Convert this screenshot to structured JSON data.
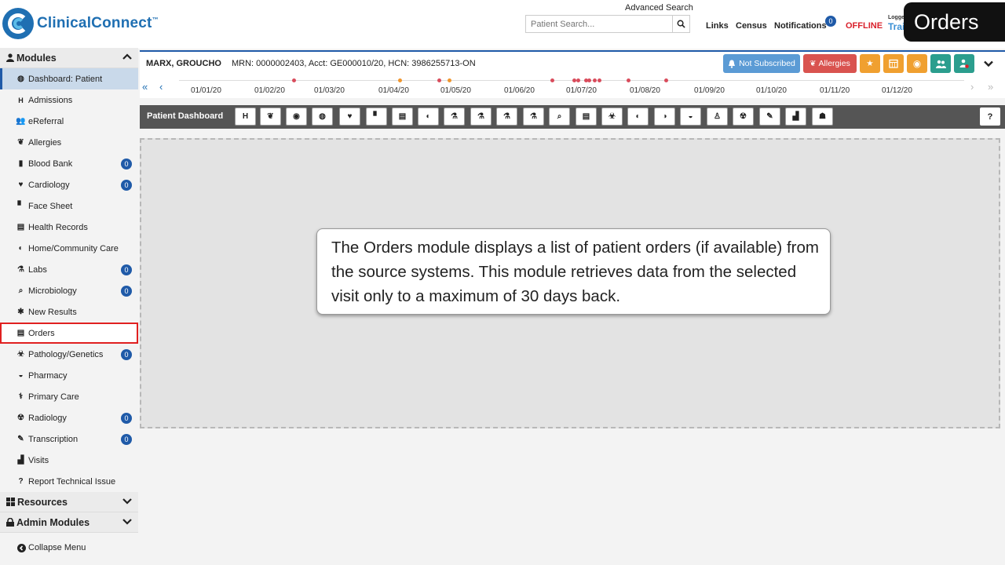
{
  "app": {
    "logo_text": "ClinicalConnect",
    "logo_tm": "™",
    "advanced_search": "Advanced Search",
    "search_placeholder": "Patient Search...",
    "links": "Links",
    "census": "Census",
    "notifications": "Notifications",
    "notifications_count": "0",
    "status": "OFFLINE",
    "logged_label": "Logge",
    "user_partial": "Trai",
    "module_title": "Orders",
    "colors": {
      "brand": "#1f6fb2",
      "offline": "#d9202b",
      "badge": "#1f5aa8",
      "highlight": "#e02020"
    }
  },
  "sidebar": {
    "modules_label": "Modules",
    "items": [
      {
        "label": "Dashboard: Patient",
        "icon": "dashboard-icon",
        "count": null
      },
      {
        "label": "Admissions",
        "icon": "hospital-h-icon",
        "count": null
      },
      {
        "label": "eReferral",
        "icon": "users-icon",
        "count": null
      },
      {
        "label": "Allergies",
        "icon": "allergy-icon",
        "count": null
      },
      {
        "label": "Blood Bank",
        "icon": "blood-bag-icon",
        "count": "0"
      },
      {
        "label": "Cardiology",
        "icon": "heart-icon",
        "count": "0"
      },
      {
        "label": "Face Sheet",
        "icon": "document-icon",
        "count": null
      },
      {
        "label": "Health Records",
        "icon": "records-icon",
        "count": null
      },
      {
        "label": "Home/Community Care",
        "icon": "home-care-icon",
        "count": null
      },
      {
        "label": "Labs",
        "icon": "flask-icon",
        "count": "0"
      },
      {
        "label": "Microbiology",
        "icon": "microscope-icon",
        "count": "0"
      },
      {
        "label": "New Results",
        "icon": "new-results-icon",
        "count": null
      },
      {
        "label": "Orders",
        "icon": "clipboard-icon",
        "count": null
      },
      {
        "label": "Pathology/Genetics",
        "icon": "biohazard-icon",
        "count": "0"
      },
      {
        "label": "Pharmacy",
        "icon": "mortar-icon",
        "count": null
      },
      {
        "label": "Primary Care",
        "icon": "stethoscope-icon",
        "count": null
      },
      {
        "label": "Radiology",
        "icon": "radiation-icon",
        "count": "0"
      },
      {
        "label": "Transcription",
        "icon": "edit-icon",
        "count": "0"
      },
      {
        "label": "Visits",
        "icon": "chart-icon",
        "count": null
      },
      {
        "label": "Report Technical Issue",
        "icon": "question-icon",
        "count": null
      }
    ],
    "resources_label": "Resources",
    "admin_label": "Admin Modules",
    "collapse_label": "Collapse Menu"
  },
  "patient": {
    "name": "MARX, GROUCHO",
    "info": "MRN: 0000002403, Acct: GE000010/20, HCN: 3986255713-ON",
    "not_subscribed": "Not Subscribed",
    "allergies": "Allergies"
  },
  "timeline": {
    "labels": [
      "01/01/20",
      "01/02/20",
      "01/03/20",
      "01/04/20",
      "01/05/20",
      "01/06/20",
      "01/07/20",
      "01/08/20",
      "01/09/20",
      "01/10/20",
      "01/11/20",
      "01/12/20"
    ]
  },
  "dashboard": {
    "title": "Patient Dashboard",
    "help": "?",
    "tools": [
      "H",
      "allergy",
      "blood",
      "blood-o",
      "heart",
      "doc",
      "print",
      "home",
      "flask",
      "micro",
      "flask2",
      "flask3",
      "search",
      "clip",
      "bio",
      "pill",
      "pill2",
      "pill3",
      "person",
      "rad",
      "edit",
      "chart",
      "users"
    ]
  },
  "callout": {
    "text": "The Orders module displays a list of patient orders (if available) from the source systems. This module retrieves data from the selected visit only to a maximum of 30 days back."
  }
}
